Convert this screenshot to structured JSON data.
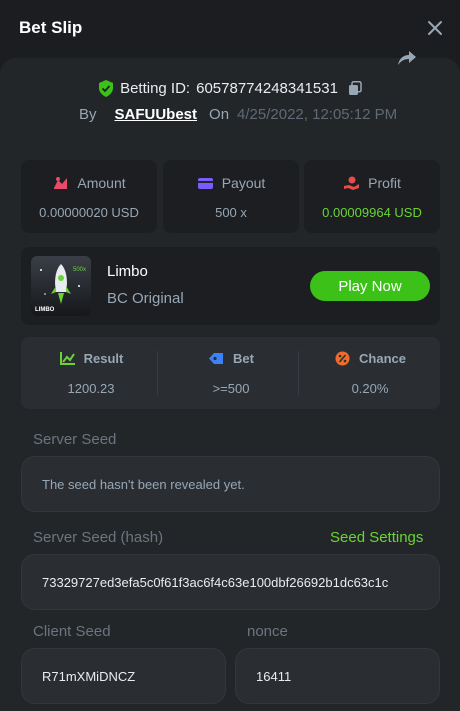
{
  "header": {
    "title": "Bet Slip"
  },
  "bet": {
    "id_label": "Betting ID:",
    "id_value": "60578774248341531",
    "by_label": "By",
    "username": "SAFUUbest",
    "on_label": "On",
    "datetime": "4/25/2022, 12:05:12 PM"
  },
  "stats": [
    {
      "label": "Amount",
      "value": "0.00000020 USD",
      "icon": "amount-icon",
      "color": "#e84b6a"
    },
    {
      "label": "Payout",
      "value": "500 x",
      "icon": "payout-icon",
      "color": "#7b5cff"
    },
    {
      "label": "Profit",
      "value": "0.00009964 USD",
      "icon": "profit-icon",
      "color": "#e84b4b",
      "value_color": "#6bd434"
    }
  ],
  "game": {
    "name": "Limbo",
    "subtitle": "BC Original",
    "thumb_text": "LIMBO",
    "thumb_badge": "500x",
    "play_label": "Play Now"
  },
  "results": [
    {
      "label": "Result",
      "value": "1200.23",
      "icon": "result-chart-icon",
      "color": "#6bd434"
    },
    {
      "label": "Bet",
      "value": ">=500",
      "icon": "bet-tag-icon",
      "color": "#3c82f6"
    },
    {
      "label": "Chance",
      "value": "0.20%",
      "icon": "chance-percent-icon",
      "color": "#f06c2a"
    }
  ],
  "seeds": {
    "server_seed_label": "Server Seed",
    "server_seed_value": "The seed hasn't been revealed yet.",
    "server_hash_label": "Server Seed (hash)",
    "seed_settings_label": "Seed Settings",
    "server_hash_value": "73329727ed3efa5c0f61f3ac6f4c63e100dbf26692b1dc63c1c",
    "client_seed_label": "Client Seed",
    "client_seed_value": "R71mXMiDNCZ",
    "nonce_label": "nonce",
    "nonce_value": "16411"
  }
}
